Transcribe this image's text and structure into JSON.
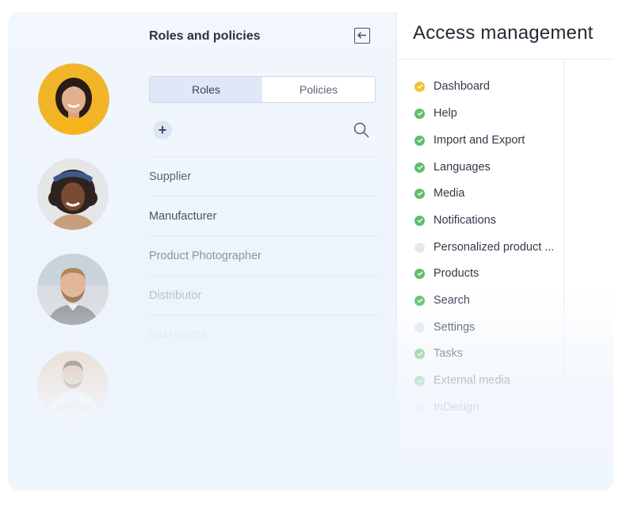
{
  "roles_panel": {
    "title": "Roles and policies",
    "collapse_icon": "arrow-left-icon",
    "tabs": [
      {
        "label": "Roles",
        "active": true
      },
      {
        "label": "Policies",
        "active": false
      }
    ],
    "add_icon": "plus-icon",
    "add_label": "+",
    "search_icon": "search-icon",
    "roles": [
      {
        "label": "Supplier"
      },
      {
        "label": "Manufacturer"
      },
      {
        "label": "Product Photographer"
      },
      {
        "label": "Distributor"
      },
      {
        "label": "DAM WRITE"
      }
    ]
  },
  "access_panel": {
    "title": "Access management",
    "permissions": [
      {
        "label": "Dashboard",
        "status": "partial"
      },
      {
        "label": "Help",
        "status": "granted"
      },
      {
        "label": "Import and Export",
        "status": "granted"
      },
      {
        "label": "Languages",
        "status": "granted"
      },
      {
        "label": "Media",
        "status": "granted"
      },
      {
        "label": "Notifications",
        "status": "granted"
      },
      {
        "label": "Personalized product ...",
        "status": "none"
      },
      {
        "label": "Products",
        "status": "granted"
      },
      {
        "label": "Search",
        "status": "granted"
      },
      {
        "label": "Settings",
        "status": "none"
      },
      {
        "label": "Tasks",
        "status": "granted"
      },
      {
        "label": "External media",
        "status": "granted"
      },
      {
        "label": "InDesign",
        "status": "none"
      }
    ]
  },
  "colors": {
    "granted": "#5fbf6a",
    "partial": "#f1c232",
    "none": "#e4e9ef",
    "segment_active": "#dfe8f7",
    "accent": "#3b4a66"
  },
  "avatars": [
    {
      "name": "avatar-woman-yellow"
    },
    {
      "name": "avatar-woman-curly"
    },
    {
      "name": "avatar-man-beard"
    },
    {
      "name": "avatar-man-crossed-arms"
    }
  ]
}
